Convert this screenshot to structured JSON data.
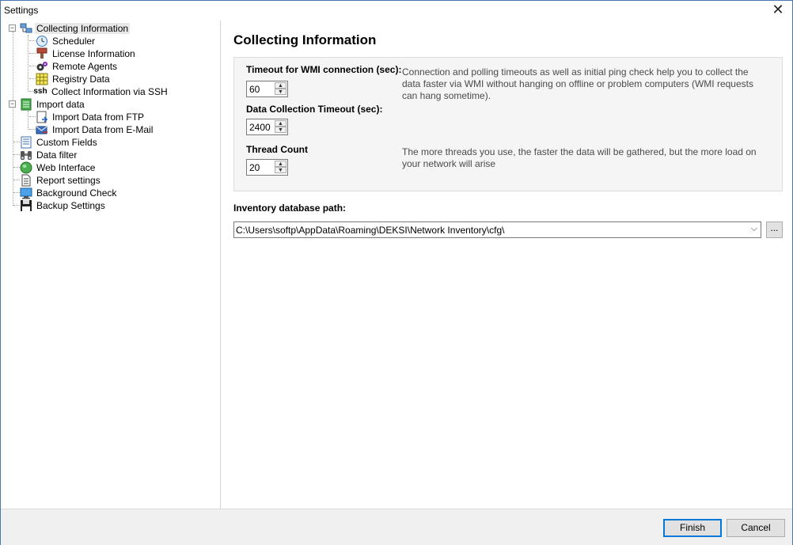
{
  "window": {
    "title": "Settings",
    "close_glyph": "✕"
  },
  "tree": {
    "items": [
      {
        "label": "Collecting Information",
        "icon": "network-computers-icon"
      },
      {
        "label": "Scheduler",
        "icon": "clock-icon"
      },
      {
        "label": "License Information",
        "icon": "license-stamp-icon"
      },
      {
        "label": "Remote Agents",
        "icon": "gears-icon"
      },
      {
        "label": "Registry Data",
        "icon": "registry-grid-icon"
      },
      {
        "label": "Collect Information via SSH",
        "icon": "ssh-text-icon",
        "icon_text": "ssh"
      },
      {
        "label": "Import data",
        "icon": "import-list-icon"
      },
      {
        "label": "Import Data from FTP",
        "icon": "ftp-import-icon"
      },
      {
        "label": "Import Data from E-Mail",
        "icon": "email-import-icon"
      },
      {
        "label": "Custom Fields",
        "icon": "custom-fields-icon"
      },
      {
        "label": "Data filter",
        "icon": "binoculars-icon"
      },
      {
        "label": "Web Interface",
        "icon": "globe-icon"
      },
      {
        "label": "Report settings",
        "icon": "report-icon"
      },
      {
        "label": "Background Check",
        "icon": "monitor-icon"
      },
      {
        "label": "Backup Settings",
        "icon": "floppy-disk-icon"
      }
    ],
    "expander_glyph": "−"
  },
  "main": {
    "heading": "Collecting Information",
    "fields": {
      "wmi_timeout": {
        "label": "Timeout for WMI connection (sec):",
        "value": "60"
      },
      "collection_timeout": {
        "label": "Data Collection Timeout (sec):",
        "value": "2400"
      },
      "thread_count": {
        "label": "Thread Count",
        "value": "20"
      }
    },
    "help_timeouts": "Connection and polling timeouts as well as initial ping check help you to collect the data faster via WMI without hanging on offline or problem computers (WMI requests can hang sometime).",
    "help_threads": "The more threads you use, the faster the data will be gathered, but the more load on your network will arise",
    "spin_up": "▲",
    "spin_down": "▼",
    "db_path_label": "Inventory database path:",
    "db_path_value": "C:\\Users\\softp\\AppData\\Roaming\\DEKSI\\Network Inventory\\cfg\\",
    "combo_arrow": "⌵",
    "browse_label": "..."
  },
  "buttons": {
    "finish": "Finish",
    "cancel": "Cancel"
  }
}
